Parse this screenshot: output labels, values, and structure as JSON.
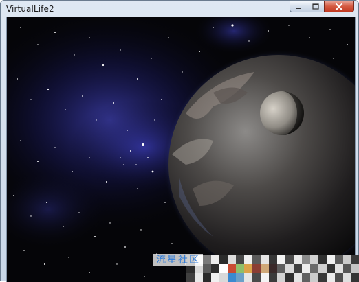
{
  "window": {
    "title": "VirtualLife2"
  },
  "caption_buttons": {
    "minimize_icon": "minimize-icon",
    "maximize_icon": "maximize-icon",
    "close_icon": "close-icon"
  },
  "scene": {
    "description_icon": "space-planet-scene"
  },
  "watermark": {
    "text": "流星社区"
  },
  "colors": {
    "title_bar": "#d4dfec",
    "close_button": "#c9452d",
    "space_background": "#050508",
    "nebula": "#3a3ad8",
    "watermark_text": "#2f7bd8"
  }
}
